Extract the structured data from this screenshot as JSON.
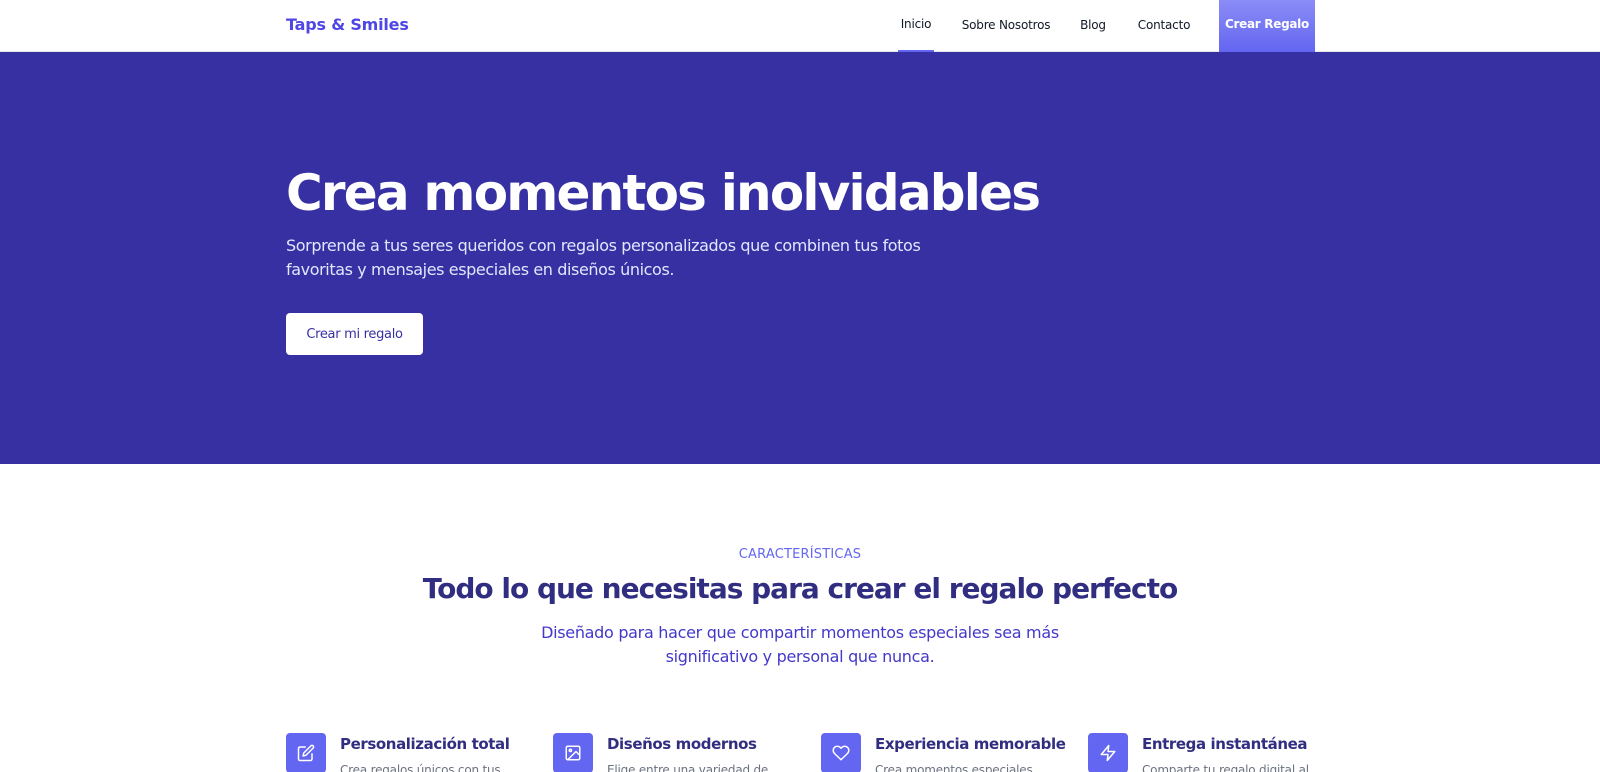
{
  "header": {
    "brand": "Taps & Smiles",
    "nav": [
      {
        "label": "Inicio",
        "active": true
      },
      {
        "label": "Sobre Nosotros",
        "active": false
      },
      {
        "label": "Blog",
        "active": false
      },
      {
        "label": "Contacto",
        "active": false
      }
    ],
    "cta_label": "Crear Regalo"
  },
  "hero": {
    "title": "Crea momentos inolvidables",
    "subtitle": "Sorprende a tus seres queridos con regalos personalizados que combinen tus fotos favoritas y mensajes especiales en diseños únicos.",
    "button_label": "Crear mi regalo"
  },
  "features": {
    "eyebrow": "CARACTERÍSTICAS",
    "title": "Todo lo que necesitas para crear el regalo perfecto",
    "subtitle": "Diseñado para hacer que compartir momentos especiales sea más significativo y personal que nunca.",
    "items": [
      {
        "name": "Personalización total",
        "desc": "Crea regalos únicos con tus",
        "icon": "edit-icon"
      },
      {
        "name": "Diseños modernos",
        "desc": "Elige entre una variedad de",
        "icon": "image-icon"
      },
      {
        "name": "Experiencia memorable",
        "desc": "Crea momentos especiales",
        "icon": "heart-icon"
      },
      {
        "name": "Entrega instantánea",
        "desc": "Comparte tu regalo digital al",
        "icon": "lightning-icon"
      }
    ]
  },
  "colors": {
    "brand": "#4f46e5",
    "hero_bg": "#3730a3",
    "accent": "#6366f1"
  }
}
